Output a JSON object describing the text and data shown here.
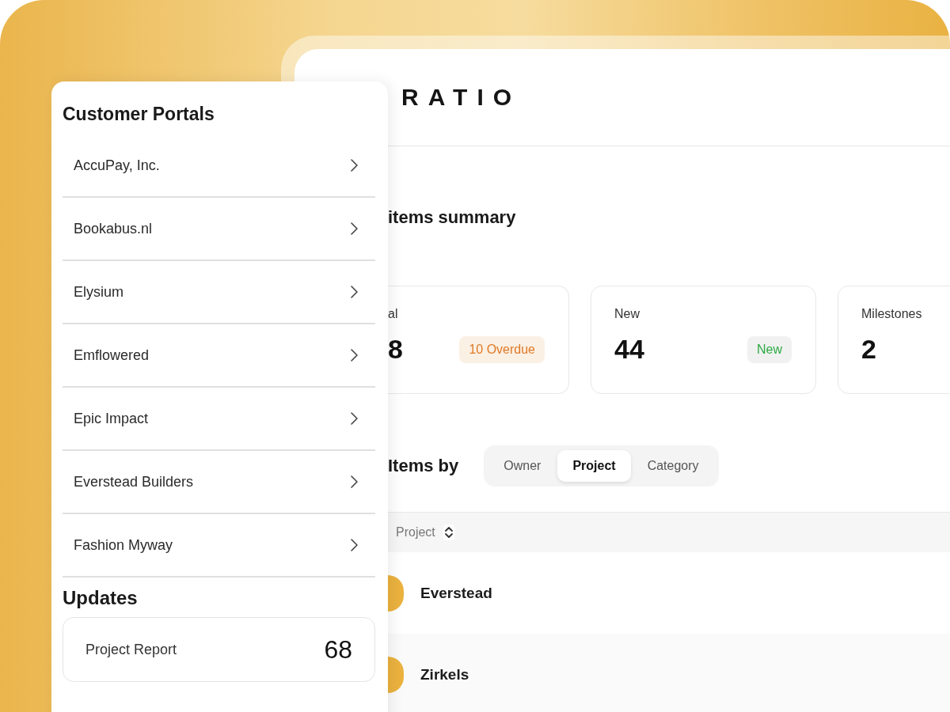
{
  "logo": "RATIO",
  "summary_title": "items summary",
  "stats": [
    {
      "label": "al",
      "value": "8",
      "badge": {
        "text": "10 Overdue",
        "kind": "warning"
      }
    },
    {
      "label": "New",
      "value": "44",
      "badge": {
        "text": "New",
        "kind": "success"
      }
    },
    {
      "label": "Milestones",
      "value": "2"
    }
  ],
  "group_title": "Items by",
  "group_tabs": [
    {
      "label": "Owner",
      "selected": false
    },
    {
      "label": "Project",
      "selected": true
    },
    {
      "label": "Category",
      "selected": false
    }
  ],
  "table": {
    "columns": [
      "Project"
    ],
    "rows": [
      {
        "name": "Everstead"
      },
      {
        "name": "Zirkels"
      }
    ]
  },
  "sidebar": {
    "title": "Customer Portals",
    "items": [
      "AccuPay, Inc.",
      "Bookabus.nl",
      "Elysium",
      "Emflowered",
      "Epic Impact",
      "Everstead Builders",
      "Fashion Myway"
    ],
    "updates_title": "Updates",
    "updates": [
      {
        "label": "Project Report",
        "count": "68"
      }
    ]
  }
}
